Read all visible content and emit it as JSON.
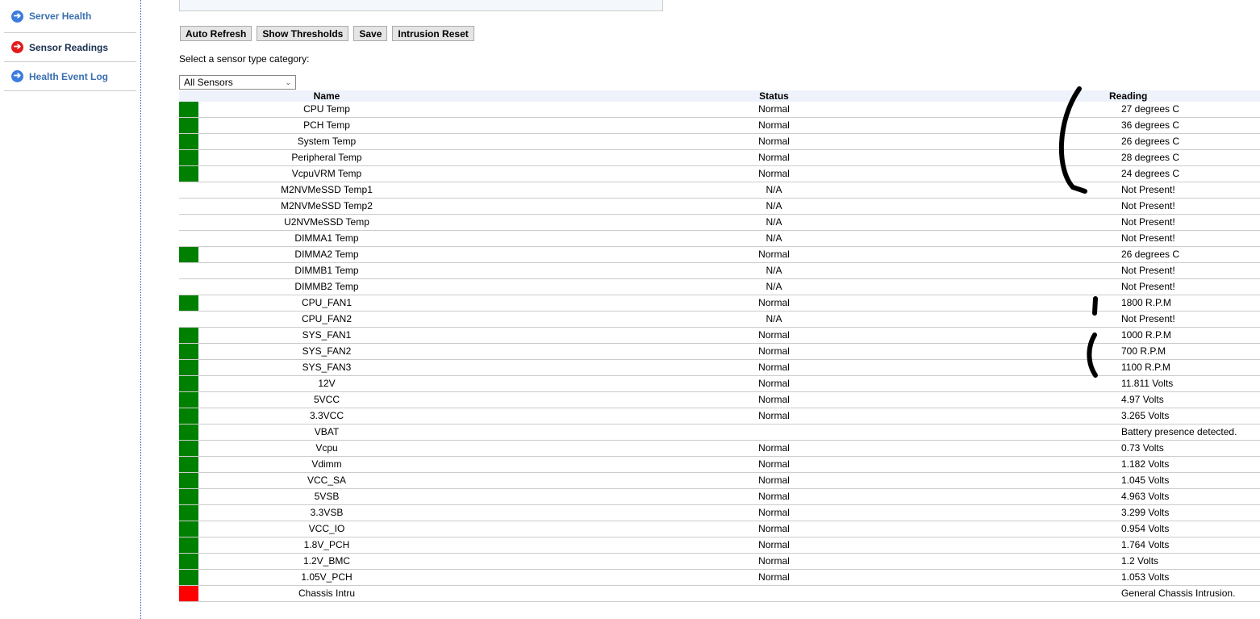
{
  "sidebar": {
    "items": [
      {
        "label": "Server Health"
      },
      {
        "label": "Sensor Readings"
      },
      {
        "label": "Health Event Log"
      }
    ]
  },
  "toolbar": {
    "auto_refresh": "Auto Refresh",
    "show_thresholds": "Show Thresholds",
    "save": "Save",
    "intrusion_reset": "Intrusion Reset"
  },
  "filter": {
    "label": "Select a sensor type category:",
    "selected": "All Sensors"
  },
  "table": {
    "headers": {
      "name": "Name",
      "status": "Status",
      "reading": "Reading"
    },
    "rows": [
      {
        "name": "CPU Temp",
        "status": "Normal",
        "reading": "27 degrees C",
        "color": "#008000"
      },
      {
        "name": "PCH Temp",
        "status": "Normal",
        "reading": "36 degrees C",
        "color": "#008000"
      },
      {
        "name": "System Temp",
        "status": "Normal",
        "reading": "26 degrees C",
        "color": "#008000"
      },
      {
        "name": "Peripheral Temp",
        "status": "Normal",
        "reading": "28 degrees C",
        "color": "#008000"
      },
      {
        "name": "VcpuVRM Temp",
        "status": "Normal",
        "reading": "24 degrees C",
        "color": "#008000"
      },
      {
        "name": "M2NVMeSSD Temp1",
        "status": "N/A",
        "reading": "Not Present!",
        "color": ""
      },
      {
        "name": "M2NVMeSSD Temp2",
        "status": "N/A",
        "reading": "Not Present!",
        "color": ""
      },
      {
        "name": "U2NVMeSSD Temp",
        "status": "N/A",
        "reading": "Not Present!",
        "color": ""
      },
      {
        "name": "DIMMA1 Temp",
        "status": "N/A",
        "reading": "Not Present!",
        "color": ""
      },
      {
        "name": "DIMMA2 Temp",
        "status": "Normal",
        "reading": "26 degrees C",
        "color": "#008000"
      },
      {
        "name": "DIMMB1 Temp",
        "status": "N/A",
        "reading": "Not Present!",
        "color": ""
      },
      {
        "name": "DIMMB2 Temp",
        "status": "N/A",
        "reading": "Not Present!",
        "color": ""
      },
      {
        "name": "CPU_FAN1",
        "status": "Normal",
        "reading": "1800 R.P.M",
        "color": "#008000"
      },
      {
        "name": "CPU_FAN2",
        "status": "N/A",
        "reading": "Not Present!",
        "color": ""
      },
      {
        "name": "SYS_FAN1",
        "status": "Normal",
        "reading": "1000 R.P.M",
        "color": "#008000"
      },
      {
        "name": "SYS_FAN2",
        "status": "Normal",
        "reading": "700 R.P.M",
        "color": "#008000"
      },
      {
        "name": "SYS_FAN3",
        "status": "Normal",
        "reading": "1100 R.P.M",
        "color": "#008000"
      },
      {
        "name": "12V",
        "status": "Normal",
        "reading": "11.811 Volts",
        "color": "#008000"
      },
      {
        "name": "5VCC",
        "status": "Normal",
        "reading": "4.97 Volts",
        "color": "#008000"
      },
      {
        "name": "3.3VCC",
        "status": "Normal",
        "reading": "3.265 Volts",
        "color": "#008000"
      },
      {
        "name": "VBAT",
        "status": "",
        "reading": "Battery presence detected.",
        "color": "#008000"
      },
      {
        "name": "Vcpu",
        "status": "Normal",
        "reading": "0.73 Volts",
        "color": "#008000"
      },
      {
        "name": "Vdimm",
        "status": "Normal",
        "reading": "1.182 Volts",
        "color": "#008000"
      },
      {
        "name": "VCC_SA",
        "status": "Normal",
        "reading": "1.045 Volts",
        "color": "#008000"
      },
      {
        "name": "5VSB",
        "status": "Normal",
        "reading": "4.963 Volts",
        "color": "#008000"
      },
      {
        "name": "3.3VSB",
        "status": "Normal",
        "reading": "3.299 Volts",
        "color": "#008000"
      },
      {
        "name": "VCC_IO",
        "status": "Normal",
        "reading": "0.954 Volts",
        "color": "#008000"
      },
      {
        "name": "1.8V_PCH",
        "status": "Normal",
        "reading": "1.764 Volts",
        "color": "#008000"
      },
      {
        "name": "1.2V_BMC",
        "status": "Normal",
        "reading": "1.2 Volts",
        "color": "#008000"
      },
      {
        "name": "1.05V_PCH",
        "status": "Normal",
        "reading": "1.053 Volts",
        "color": "#008000"
      },
      {
        "name": "Chassis Intru",
        "status": "",
        "reading": "General Chassis Intrusion.",
        "color": "#ff0000"
      }
    ]
  }
}
